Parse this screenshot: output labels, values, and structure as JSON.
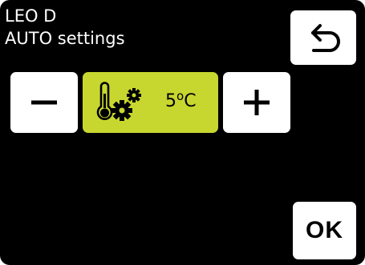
{
  "header": {
    "device_name": "LEO D",
    "screen_title": "AUTO settings"
  },
  "setting": {
    "mode_icon": "thermometer-gears-icon",
    "value": "5",
    "degree_symbol": "o",
    "unit": "C"
  },
  "buttons": {
    "back_icon": "back-arrow-icon",
    "minus_icon": "minus-icon",
    "plus_icon": "plus-icon",
    "ok_label": "OK"
  },
  "colors": {
    "background": "#000000",
    "button": "#ffffff",
    "value_highlight": "#c8d72f"
  }
}
